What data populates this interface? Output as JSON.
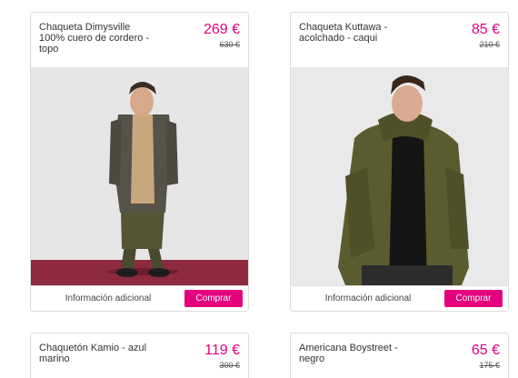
{
  "products": [
    {
      "title": "Chaqueta Dimysville\n100% cuero de cordero -\ntopo",
      "price": "269 €",
      "old_price": "630 €",
      "info_label": "Información adicional",
      "buy_label": "Comprar",
      "image": "man-in-leather-jacket"
    },
    {
      "title": "Chaqueta Kuttawa -\nacolchado - caqui",
      "price": "85 €",
      "old_price": "210 €",
      "info_label": "Información adicional",
      "buy_label": "Comprar",
      "image": "man-in-khaki-padded-jacket"
    },
    {
      "title": "Chaquetón Kamio - azul\nmarino",
      "price": "119 €",
      "old_price": "300 €"
    },
    {
      "title": "Americana Boystreet -\nnegro",
      "price": "65 €",
      "old_price": "175 €"
    }
  ],
  "colors": {
    "accent": "#e5007e",
    "card_border": "#dcdcdc"
  }
}
